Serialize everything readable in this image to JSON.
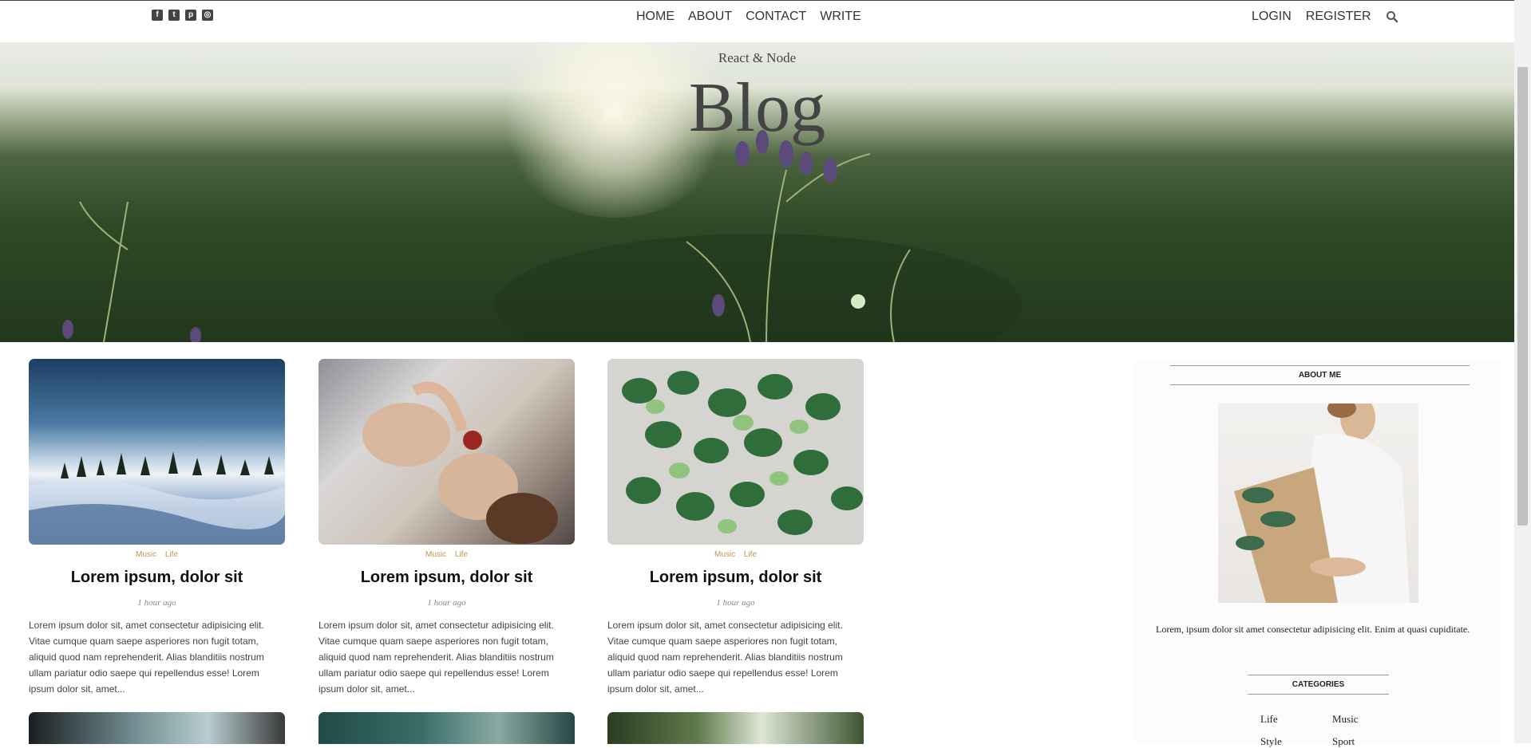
{
  "topbar": {
    "social_icons": [
      "facebook-square-icon",
      "twitter-square-icon",
      "pinterest-square-icon",
      "instagram-square-icon"
    ],
    "nav": [
      "HOME",
      "ABOUT",
      "CONTACT",
      "WRITE"
    ],
    "login": "LOGIN",
    "register": "REGISTER",
    "search_icon": "search-icon"
  },
  "hero": {
    "subtitle": "React & Node",
    "title": "Blog"
  },
  "posts": [
    {
      "cats": [
        "Music",
        "Life"
      ],
      "title": "Lorem ipsum, dolor sit",
      "date": "1 hour ago",
      "desc": "Lorem ipsum dolor sit, amet consectetur adipisicing elit. Vitae cumque quam saepe asperiores non fugit totam, aliquid quod nam reprehenderit. Alias blanditiis nostrum ullam pariatur odio saepe qui repellendus esse! Lorem ipsum dolor sit, amet..."
    },
    {
      "cats": [
        "Music",
        "Life"
      ],
      "title": "Lorem ipsum, dolor sit",
      "date": "1 hour ago",
      "desc": "Lorem ipsum dolor sit, amet consectetur adipisicing elit. Vitae cumque quam saepe asperiores non fugit totam, aliquid quod nam reprehenderit. Alias blanditiis nostrum ullam pariatur odio saepe qui repellendus esse! Lorem ipsum dolor sit, amet..."
    },
    {
      "cats": [
        "Music",
        "Life"
      ],
      "title": "Lorem ipsum, dolor sit",
      "date": "1 hour ago",
      "desc": "Lorem ipsum dolor sit, amet consectetur adipisicing elit. Vitae cumque quam saepe asperiores non fugit totam, aliquid quod nam reprehenderit. Alias blanditiis nostrum ullam pariatur odio saepe qui repellendus esse! Lorem ipsum dolor sit, amet..."
    }
  ],
  "sidebar": {
    "about_title": "ABOUT ME",
    "about_text": "Lorem, ipsum dolor sit amet consectetur adipisicing elit. Enim at quasi cupiditate.",
    "categories_title": "CATEGORIES",
    "categories": [
      "Life",
      "Music",
      "Style",
      "Sport"
    ]
  }
}
